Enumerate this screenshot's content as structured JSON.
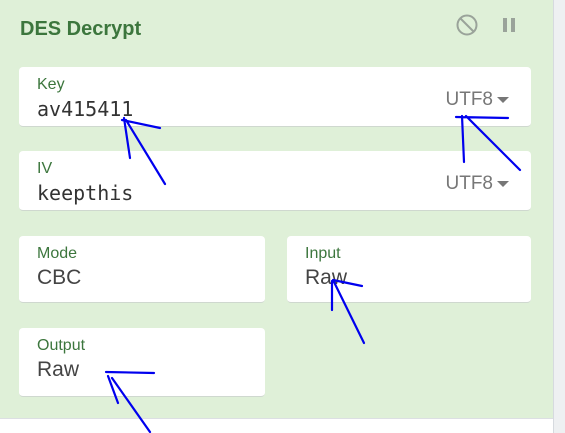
{
  "operation": {
    "title": "DES Decrypt",
    "controls": {
      "disable_icon": "disable-icon",
      "pause_icon": "pause-icon"
    },
    "key": {
      "label": "Key",
      "value": "av415411",
      "encoding": "UTF8"
    },
    "iv": {
      "label": "IV",
      "value": "keepthis",
      "encoding": "UTF8"
    },
    "mode": {
      "label": "Mode",
      "value": "CBC"
    },
    "input": {
      "label": "Input",
      "value": "Raw"
    },
    "output": {
      "label": "Output",
      "value": "Raw"
    }
  },
  "colors": {
    "panel_background": "#dff0d8",
    "title": "#3c763d",
    "annotation_ink": "#0000ee"
  }
}
